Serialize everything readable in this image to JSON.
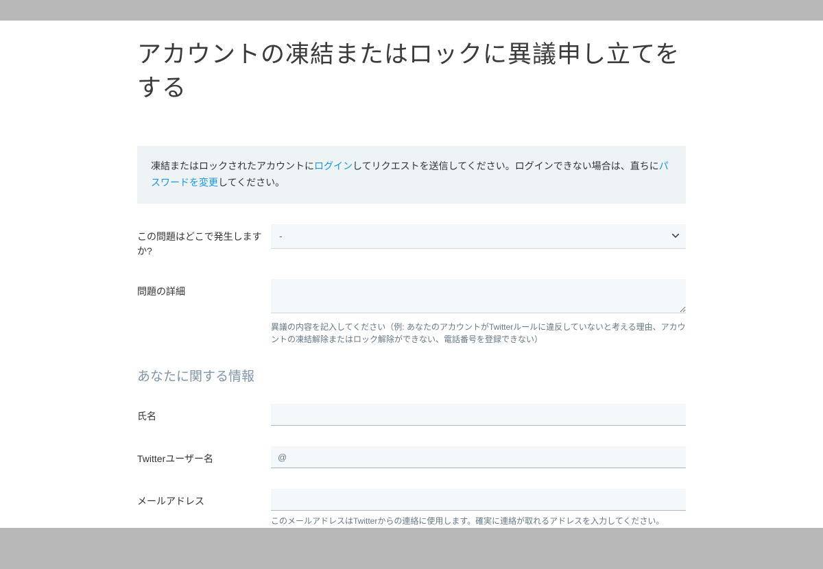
{
  "page": {
    "title": "アカウントの凍結またはロックに異議申し立てをする"
  },
  "info_box": {
    "text_1": "凍結またはロックされたアカウントに",
    "link_1": "ログイン",
    "text_2": "してリクエストを送信してください。ログインできない場合は、直ちに",
    "link_2": "パスワードを変更",
    "text_3": "してください。"
  },
  "form": {
    "where_label": "この問題はどこで発生しますか?",
    "where_selected": "-",
    "details_label": "問題の詳細",
    "details_help": "異議の内容を記入してください（例: あなたのアカウントがTwitterルールに違反していないと考える理由、アカウントの凍結解除またはロック解除ができない、電話番号を登録できない）",
    "section_heading": "あなたに関する情報",
    "name_label": "氏名",
    "username_label": "Twitterユーザー名",
    "username_prefix": "@",
    "email_label": "メールアドレス",
    "email_help": "このメールアドレスはTwitterからの連絡に使用します。確実に連絡が取れるアドレスを入力してください。"
  }
}
